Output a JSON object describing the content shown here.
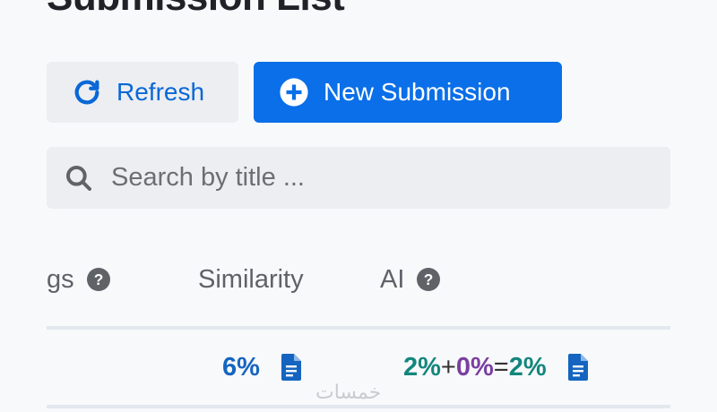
{
  "page": {
    "title": "Submission List"
  },
  "toolbar": {
    "refresh_label": "Refresh",
    "new_submission_label": "New Submission",
    "refresh_icon": "refresh-icon",
    "new_icon": "plus-circle-icon"
  },
  "search": {
    "placeholder": "Search by title ...",
    "icon": "search-icon"
  },
  "table": {
    "headers": {
      "flags_partial": "gs",
      "similarity": "Similarity",
      "ai": "AI"
    },
    "rows": [
      {
        "similarity": "6%",
        "ai_human": "2%",
        "ai_plus": "+",
        "ai_paraphrase": "0%",
        "ai_equals": "=",
        "ai_total": "2%"
      }
    ]
  },
  "watermark": "خمسات",
  "colors": {
    "primary": "#0a6fe8",
    "link_blue": "#0a67d6",
    "ai_teal": "#14867d",
    "ai_purple": "#7b3fa0"
  }
}
